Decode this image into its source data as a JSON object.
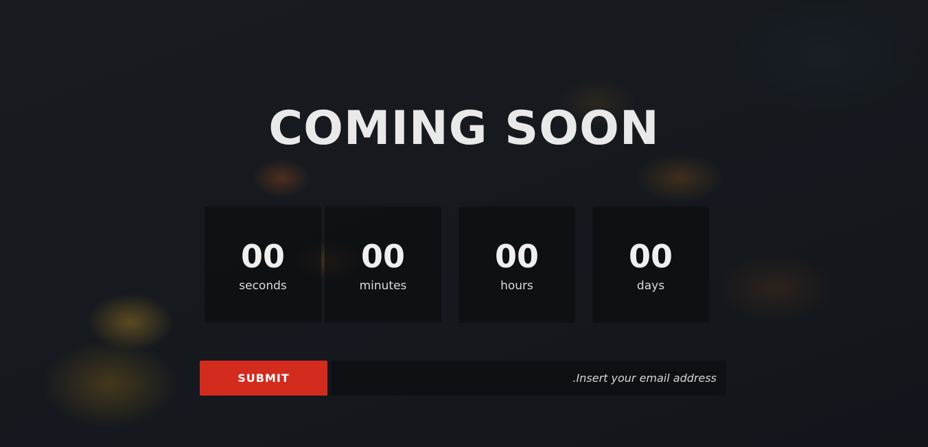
{
  "page": {
    "title": "COMING SOON"
  },
  "countdown": [
    {
      "value": "00",
      "label": "seconds"
    },
    {
      "value": "00",
      "label": "minutes"
    },
    {
      "value": "00",
      "label": "hours"
    },
    {
      "value": "00",
      "label": "days"
    }
  ],
  "form": {
    "submit_label": "SUBMIT",
    "email_placeholder": "Insert your email address."
  },
  "colors": {
    "accent": "#d42b1f",
    "text": "#ececec",
    "background": "#1a1f24"
  }
}
